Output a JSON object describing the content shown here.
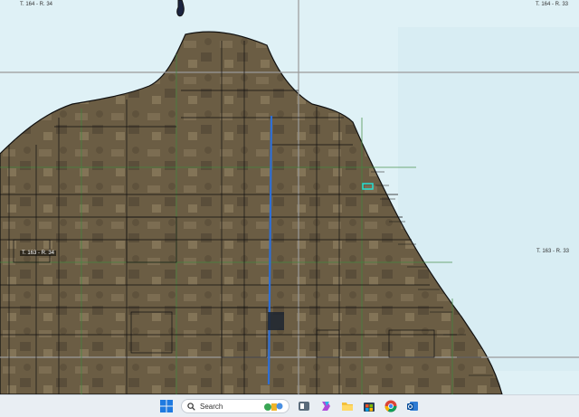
{
  "map": {
    "labels": {
      "t164_r34": "T. 164 - R. 34",
      "t164_r33": "T. 164 - R. 33",
      "t163_r34": "T. 163 - R. 34",
      "t163_r33": "T. 163 - R. 33"
    },
    "colors": {
      "water": "#dff1f6",
      "land": "#6b5d44",
      "parcel_lines": "#111111",
      "section_lines": "#3f8a3f",
      "township_lines": "#9a9a9a",
      "highlight_road": "#2f6fd6",
      "selected_parcel": "#26e0d4"
    }
  },
  "taskbar": {
    "search_placeholder": "Search",
    "icons": [
      "windows-start-icon",
      "widgets-icon",
      "copilot-icon",
      "file-explorer-icon",
      "store-icon",
      "chrome-icon",
      "outlook-icon"
    ]
  }
}
